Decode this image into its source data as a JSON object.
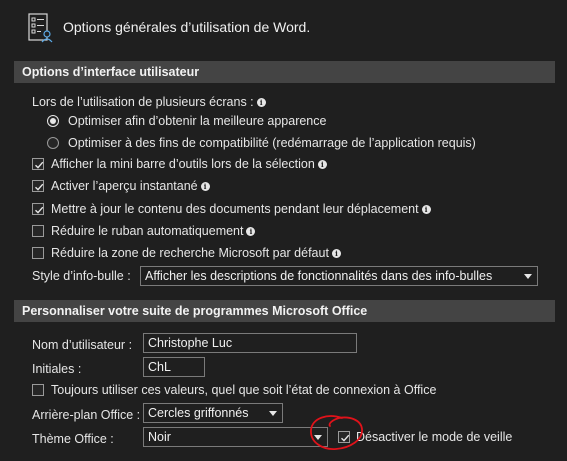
{
  "header": {
    "title": "Options générales d’utilisation de Word.",
    "icon": "options-list-icon"
  },
  "ui_section": {
    "title": "Options d’interface utilisateur",
    "multi_screen_label": "Lors de l’utilisation de plusieurs écrans :",
    "radio_options": [
      {
        "label": "Optimiser afin d’obtenir la meilleure apparence",
        "selected": true
      },
      {
        "label": "Optimiser à des fins de compatibilité (redémarrage de l’application requis)",
        "selected": false
      }
    ],
    "checkboxes": [
      {
        "label": "Afficher la mini barre d’outils lors de la sélection",
        "checked": true
      },
      {
        "label": "Activer l’aperçu instantané",
        "checked": true
      },
      {
        "label": "Mettre à jour le contenu des documents pendant leur déplacement",
        "checked": true
      },
      {
        "label": "Réduire le ruban automatiquement",
        "checked": false
      },
      {
        "label": "Réduire la zone de recherche Microsoft par défaut",
        "checked": false
      }
    ],
    "tooltip_style_label": "Style d’info-bulle :",
    "tooltip_style_value": "Afficher les descriptions de fonctionnalités dans des info-bulles"
  },
  "office_section": {
    "title": "Personnaliser votre suite de programmes Microsoft Office",
    "username_label": "Nom d’utilisateur :",
    "username_value": "Christophe Luc",
    "initials_label": "Initiales :",
    "initials_value": "ChL",
    "always_use_label": "Toujours utiliser ces valeurs, quel que soit l’état de connexion à Office",
    "always_use_checked": false,
    "background_label": "Arrière-plan Office :",
    "background_value": "Cercles griffonnés",
    "theme_label": "Thème Office :",
    "theme_value": "Noir",
    "sleep_label": "Désactiver le mode de veille",
    "sleep_checked": true
  },
  "colors": {
    "background": "#1f1f1f",
    "section_bar": "#444444",
    "annotation_red": "#e0121a"
  }
}
